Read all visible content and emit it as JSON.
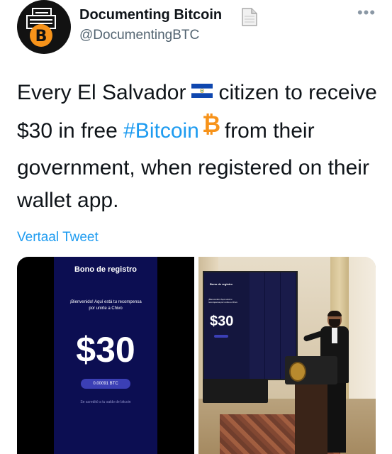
{
  "account": {
    "display_name": "Documenting Bitcoin",
    "handle": "@DocumentingBTC",
    "avatar_icon": "documenting-bitcoin-logo",
    "badge_icon": "document-icon",
    "more_icon": "more-dots-icon"
  },
  "tweet": {
    "text_part1": "Every El Salvador",
    "flag_icon": "el-salvador-flag-icon",
    "text_part2": "citizen to receive $30 in free",
    "hashtag": "#Bitcoin",
    "bitcoin_icon": "bitcoin-icon",
    "text_part3": "from their government, when registered on their wallet app."
  },
  "translate_link": "Vertaal Tweet",
  "media": {
    "left_image": {
      "title": "Bono de registro",
      "welcome": "¡Bienvenido! Aquí está tu recompensa por unirte a Chivo",
      "amount": "$30",
      "btc_pill": "0.00091 BTC",
      "footnote": "Se acreditó a tu saldo de bitcoin"
    },
    "right_image": {
      "screen_title": "Bono de registro",
      "screen_text": "¡Bienvenido! Aquí está tu recompensa por unirte a Chivo",
      "screen_amount": "$30"
    }
  },
  "colors": {
    "link": "#1d9bf0",
    "text": "#0f1419",
    "muted": "#536471",
    "bitcoin_orange": "#f7931a",
    "app_background": "#0c0e52"
  }
}
